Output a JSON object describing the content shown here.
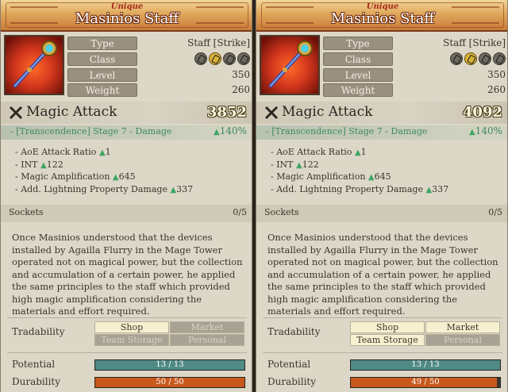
{
  "panels": [
    {
      "rarity": "Unique",
      "name": "Masinios Staff",
      "stats": {
        "type_label": "Type",
        "type_value": "Staff [Strike]",
        "class_label": "Class",
        "level_label": "Level",
        "level_value": "350",
        "weight_label": "Weight",
        "weight_value": "260"
      },
      "class_icons": [
        "sword-class-icon",
        "staff-class-icon",
        "bow-class-icon",
        "cross-class-icon"
      ],
      "attack_label": "Magic Attack",
      "attack_value": "3852",
      "transcendence_label": "- [Transcendence] Stage 7 - Damage",
      "transcendence_value": "140%",
      "bonuses": [
        {
          "label": "- AoE Attack Ratio",
          "value": "1"
        },
        {
          "label": "- INT",
          "value": "122"
        },
        {
          "label": "- Magic Amplification",
          "value": "645"
        },
        {
          "label": "- Add. Lightning Property Damage",
          "value": "337"
        }
      ],
      "sockets_label": "Sockets",
      "sockets_value": "0/5",
      "description": "Once Masinios understood that the devices installed by Agailla Flurry in the Mage Tower operated not on magical power, but the collection and accumulation of a certain power, he applied the same principles to the staff which provided high magic amplification considering the materials and effort required.",
      "tradability_label": "Tradability",
      "trade": {
        "shop": "Shop",
        "market": "Market",
        "team_storage": "Team Storage",
        "personal": "Personal"
      },
      "potential_label": "Potential",
      "potential_value": "13 / 13",
      "potential_fraction": 1.0,
      "durability_label": "Durability",
      "durability_value": "50 / 50",
      "durability_fraction": 1.0
    },
    {
      "rarity": "Unique",
      "name": "Masinios Staff",
      "stats": {
        "type_label": "Type",
        "type_value": "Staff [Strike]",
        "class_label": "Class",
        "level_label": "Level",
        "level_value": "350",
        "weight_label": "Weight",
        "weight_value": "260"
      },
      "class_icons": [
        "sword-class-icon",
        "staff-class-icon",
        "bow-class-icon",
        "cross-class-icon"
      ],
      "attack_label": "Magic Attack",
      "attack_value": "4092",
      "transcendence_label": "- [Transcendence] Stage 7 - Damage",
      "transcendence_value": "140%",
      "bonuses": [
        {
          "label": "- AoE Attack Ratio",
          "value": "1"
        },
        {
          "label": "- INT",
          "value": "122"
        },
        {
          "label": "- Magic Amplification",
          "value": "645"
        },
        {
          "label": "- Add. Lightning Property Damage",
          "value": "337"
        }
      ],
      "sockets_label": "Sockets",
      "sockets_value": "0/5",
      "description": "Once Masinios understood that the devices installed by Agailla Flurry in the Mage Tower operated not on magical power, but the collection and accumulation of a certain power, he applied the same principles to the staff which provided high magic amplification considering the materials and effort required.",
      "tradability_label": "Tradability",
      "trade": {
        "shop": "Shop",
        "market": "Market",
        "team_storage": "Team Storage",
        "personal": "Personal"
      },
      "potential_label": "Potential",
      "potential_value": "13 / 13",
      "potential_fraction": 1.0,
      "durability_label": "Durability",
      "durability_value": "49 / 50",
      "durability_fraction": 0.98
    }
  ]
}
